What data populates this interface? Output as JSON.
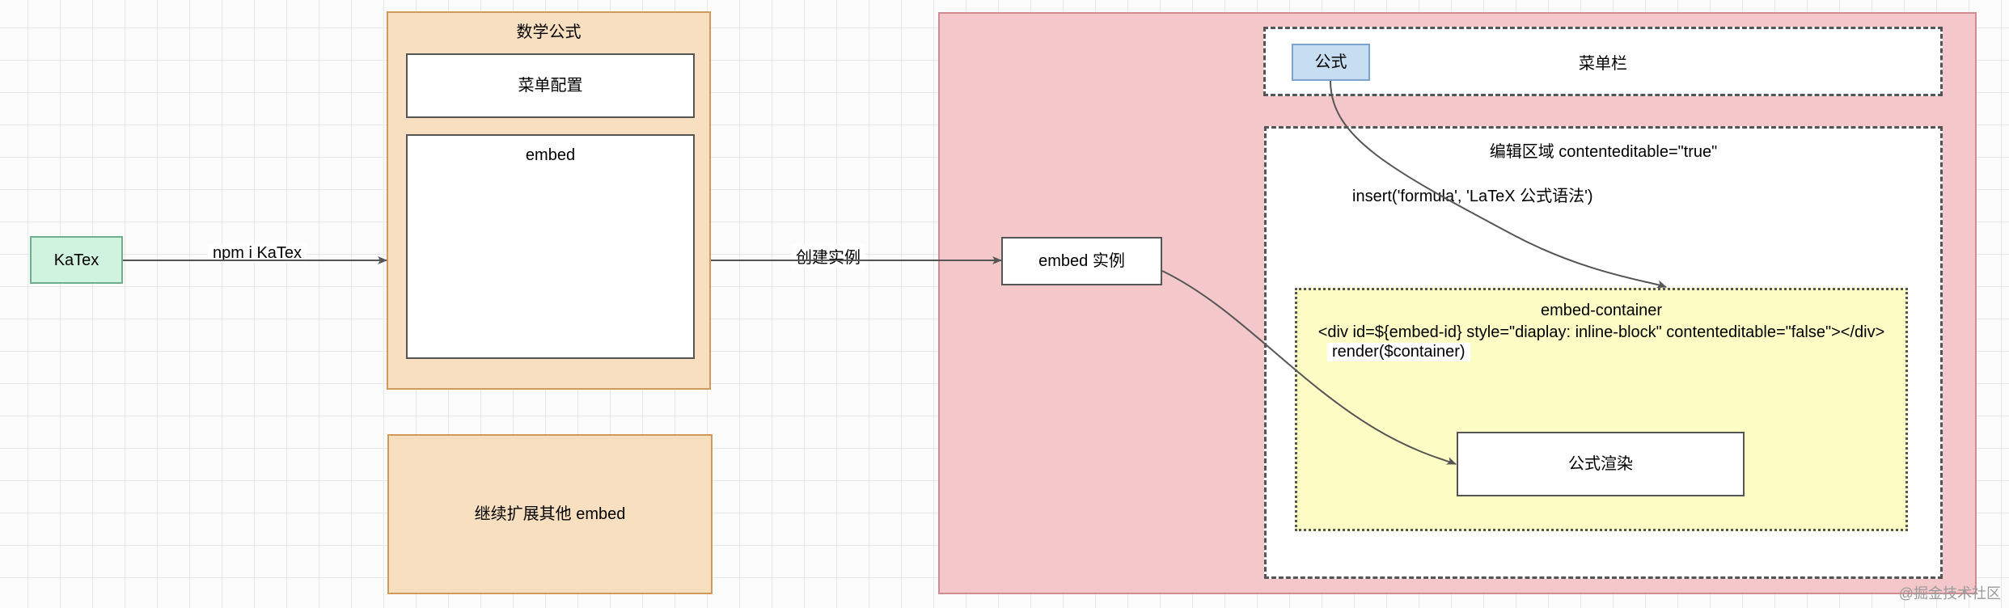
{
  "nodes": {
    "katex": "KaTex",
    "math_group_title": "数学公式",
    "menu_config": "菜单配置",
    "embed": "embed",
    "extend_embed": "继续扩展其他 embed",
    "embed_instance": "embed 实例",
    "formula_tab": "公式",
    "menubar": "菜单栏",
    "edit_area_label": "编辑区域 contenteditable=\"true\"",
    "embed_container_title": "embed-container",
    "embed_container_code": "<div id=${embed-id} style=\"diaplay: inline-block\" contenteditable=\"false\"></div>",
    "formula_render": "公式渲染"
  },
  "edges": {
    "npm_i_katex": "npm i KaTex",
    "create_instance": "创建实例",
    "insert_formula": "insert('formula', 'LaTeX 公式语法')",
    "render_container": "render($container)"
  },
  "watermark": "@掘金技术社区"
}
